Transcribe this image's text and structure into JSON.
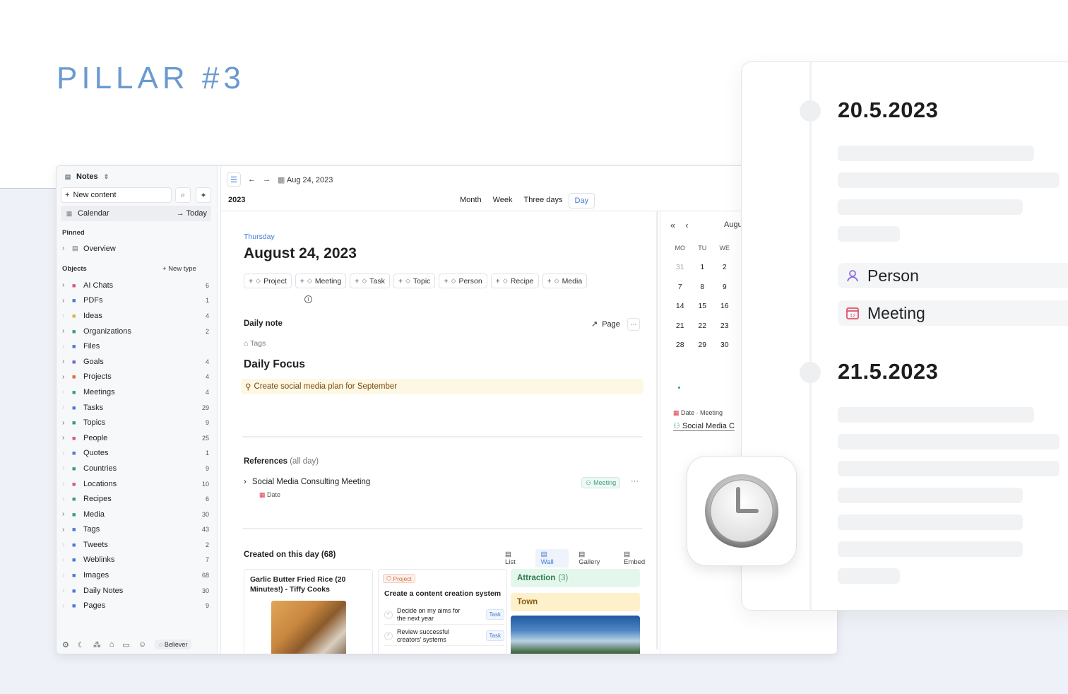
{
  "heading": "PILLAR #3",
  "sidebar": {
    "workspace": "Notes",
    "new_content": "New content",
    "calendar": "Calendar",
    "today": "Today",
    "pinned_label": "Pinned",
    "pinned": [
      {
        "label": "Overview"
      }
    ],
    "objects_label": "Objects",
    "new_type": "New type",
    "objects": [
      {
        "label": "AI Chats",
        "count": "6",
        "icon": "chat-icon",
        "color": "#d9508f",
        "expandable": true
      },
      {
        "label": "PDFs",
        "count": "1",
        "icon": "pdf-icon",
        "color": "#4a78d4",
        "expandable": true
      },
      {
        "label": "Ideas",
        "count": "4",
        "icon": "lightbulb-icon",
        "color": "#d8b23a",
        "expandable": false
      },
      {
        "label": "Organizations",
        "count": "2",
        "icon": "building-icon",
        "color": "#3f9a6a",
        "expandable": true
      },
      {
        "label": "Files",
        "count": "",
        "icon": "file-icon",
        "color": "#4a78d4",
        "expandable": false
      },
      {
        "label": "Goals",
        "count": "4",
        "icon": "target-icon",
        "color": "#7a5bd6",
        "expandable": true
      },
      {
        "label": "Projects",
        "count": "4",
        "icon": "cube-icon",
        "color": "#e0683a",
        "expandable": true
      },
      {
        "label": "Meetings",
        "count": "4",
        "icon": "people-icon",
        "color": "#3a9a80",
        "expandable": false
      },
      {
        "label": "Tasks",
        "count": "29",
        "icon": "check-icon",
        "color": "#4a78d4",
        "expandable": false
      },
      {
        "label": "Topics",
        "count": "9",
        "icon": "edit-icon",
        "color": "#3f9a6a",
        "expandable": true
      },
      {
        "label": "People",
        "count": "25",
        "icon": "person-icon",
        "color": "#d9508f",
        "expandable": true
      },
      {
        "label": "Quotes",
        "count": "1",
        "icon": "quote-icon",
        "color": "#4a78d4",
        "expandable": false
      },
      {
        "label": "Countries",
        "count": "9",
        "icon": "pin-icon",
        "color": "#3f9a6a",
        "expandable": false
      },
      {
        "label": "Locations",
        "count": "10",
        "icon": "location-icon",
        "color": "#d9508f",
        "expandable": false
      },
      {
        "label": "Recipes",
        "count": "6",
        "icon": "recipe-icon",
        "color": "#3f9a6a",
        "expandable": false
      },
      {
        "label": "Media",
        "count": "30",
        "icon": "media-icon",
        "color": "#3a9a80",
        "expandable": true
      },
      {
        "label": "Tags",
        "count": "43",
        "icon": "tag-icon",
        "color": "#4a78d4",
        "expandable": true
      },
      {
        "label": "Tweets",
        "count": "2",
        "icon": "tweet-icon",
        "color": "#4a78d4",
        "expandable": false
      },
      {
        "label": "Weblinks",
        "count": "7",
        "icon": "globe-icon",
        "color": "#4a78d4",
        "expandable": false
      },
      {
        "label": "Images",
        "count": "68",
        "icon": "image-icon",
        "color": "#4a78d4",
        "expandable": false
      },
      {
        "label": "Daily Notes",
        "count": "30",
        "icon": "calendar-icon",
        "color": "#4a78d4",
        "expandable": false
      },
      {
        "label": "Pages",
        "count": "9",
        "icon": "page-icon",
        "color": "#4a78d4",
        "expandable": false
      }
    ],
    "plan": "Believer"
  },
  "main": {
    "date_label": "Aug 24, 2023",
    "year": "2023",
    "views": [
      "Month",
      "Week",
      "Three days",
      "Day"
    ],
    "active_view": "Day",
    "weekday": "Thursday",
    "title": "August 24, 2023",
    "chips": [
      {
        "label": "Project",
        "icon": "cube-icon"
      },
      {
        "label": "Meeting",
        "icon": "people-icon"
      },
      {
        "label": "Task",
        "icon": "check-icon"
      },
      {
        "label": "Topic",
        "icon": "edit-icon"
      },
      {
        "label": "Person",
        "icon": "person-icon"
      },
      {
        "label": "Recipe",
        "icon": "recipe-icon"
      },
      {
        "label": "Media",
        "icon": "media-icon"
      }
    ],
    "daily_note": "Daily note",
    "page_label": "Page",
    "tags_placeholder": "Tags",
    "focus_heading": "Daily Focus",
    "focus_item": "Create social media plan for September",
    "references_label": "References",
    "references_scope": "(all day)",
    "reference_title": "Social Media Consulting Meeting",
    "reference_sub": "Date",
    "reference_badge": "Meeting",
    "created_label": "Created on this day (68)",
    "view_tabs": [
      "List",
      "Wall",
      "Gallery",
      "Embed"
    ],
    "active_tab": "Wall",
    "card1_title": "Garlic Butter Fried Rice (20 Minutes!) - Tiffy Cooks",
    "card2_badge": "Project",
    "card2_title": "Create a content creation system",
    "card2_tasks": [
      {
        "text": "Decide on my aims for the next year",
        "badge": "Task"
      },
      {
        "text": "Review successful creators' systems",
        "badge": "Task"
      }
    ],
    "group1_label": "Attraction",
    "group1_count": "(3)",
    "group2_label": "Town"
  },
  "mini_calendar": {
    "month": "Augu",
    "weekdays": [
      "MO",
      "TU",
      "WE"
    ],
    "rows": [
      [
        "31",
        "1",
        "2"
      ],
      [
        "7",
        "8",
        "9"
      ],
      [
        "14",
        "15",
        "16"
      ],
      [
        "21",
        "22",
        "23"
      ],
      [
        "28",
        "29",
        "30"
      ]
    ],
    "event_header": "Date · Meeting",
    "event_title": "Social Media C"
  },
  "overlay": {
    "date1": "20.5.2023",
    "tag1": "Person",
    "tag2": "Meeting",
    "tag2_day": "12",
    "date2": "21.5.2023"
  }
}
